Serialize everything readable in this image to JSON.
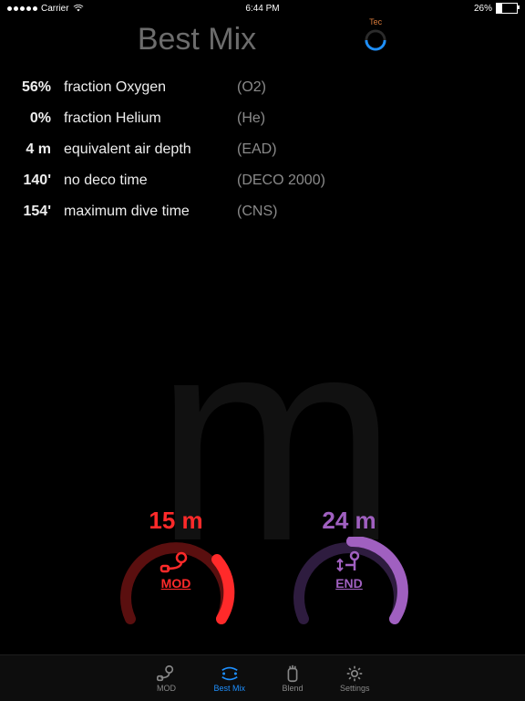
{
  "status": {
    "carrier": "Carrier",
    "time": "6:44 PM",
    "battery": "26%"
  },
  "title": "Best Mix",
  "tec_label": "Tec",
  "rows": [
    {
      "value": "56%",
      "label": "fraction Oxygen",
      "code": "(O2)"
    },
    {
      "value": "0%",
      "label": "fraction Helium",
      "code": "(He)"
    },
    {
      "value": "4 m",
      "label": "equivalent air depth",
      "code": "(EAD)"
    },
    {
      "value": "140'",
      "label": "no deco time",
      "code": "(DECO 2000)"
    },
    {
      "value": "154'",
      "label": "maximum dive time",
      "code": "(CNS)"
    }
  ],
  "dials": {
    "mod": {
      "value": "15 m",
      "caption": "MOD"
    },
    "end": {
      "value": "24 m",
      "caption": "END"
    }
  },
  "tabs": {
    "mod": "MOD",
    "bestmix": "Best Mix",
    "blend": "Blend",
    "settings": "Settings"
  },
  "watermark": "m"
}
